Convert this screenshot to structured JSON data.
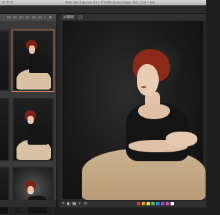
{
  "window": {
    "title": "Alien Skin Exposure X3 • STYLISH Eruma Rutger Elite 1234 • Realize Rutger • Bryndís — Bec"
  },
  "sidebar": {
    "close_label": "×"
  },
  "viewer": {
    "toolbar": {
      "mode_label": "▾ SERIF"
    },
    "bottom_tools": [
      "✎",
      "◐",
      "▦",
      "⌖",
      "⟲"
    ],
    "swatch_colors": [
      "#d93c3c",
      "#e0a12c",
      "#e8e23a",
      "#4cc24c",
      "#3a8ae0",
      "#9a4ad0",
      "#d04ab4",
      "#ffffff"
    ]
  },
  "colors": {
    "accent": "#ff9a6a",
    "background": "#1e1e1e",
    "panel": "#3a3a3a"
  }
}
